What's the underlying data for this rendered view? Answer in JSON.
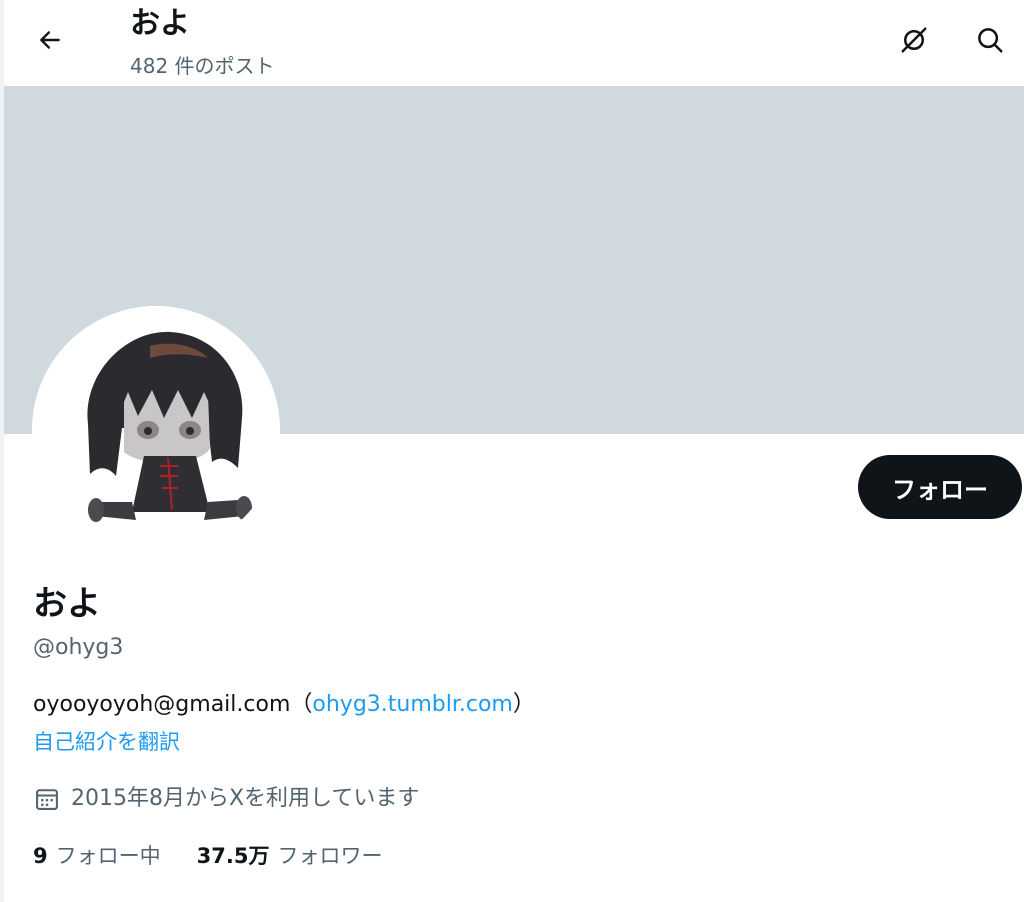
{
  "header": {
    "title": "およ",
    "subtitle": "482 件のポスト",
    "back_icon": "back-arrow-icon",
    "grok_icon": "grok-icon",
    "search_icon": "search-icon"
  },
  "profile": {
    "display_name": "およ",
    "handle": "@ohyg3",
    "follow_label": "フォロー",
    "bio_text": "oyooyoyoh@gmail.com（",
    "bio_link": "ohyg3.tumblr.com",
    "bio_suffix": "）",
    "translate_label": "自己紹介を翻訳",
    "joined_text": "2015年8月からXを利用しています",
    "joined_icon": "calendar-icon",
    "following_count": "9",
    "following_label": "フォロー中",
    "followers_count": "37.5万",
    "followers_label": "フォロワー"
  },
  "colors": {
    "banner": "#cfd9de",
    "accent": "#1d9bf0",
    "primary_text": "#0f1419",
    "secondary_text": "#536471",
    "follow_bg": "#0f1419"
  }
}
